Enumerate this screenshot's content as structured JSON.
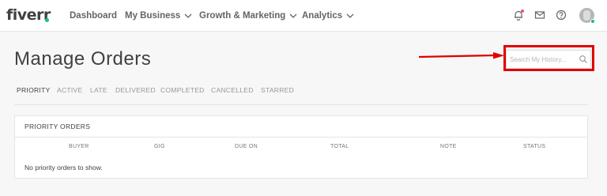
{
  "nav": {
    "logo": "fiverr",
    "items": [
      "Dashboard",
      "My Business",
      "Growth & Marketing",
      "Analytics"
    ],
    "icons": [
      "bell-icon",
      "envelope-icon",
      "help-icon"
    ]
  },
  "page": {
    "title": "Manage Orders"
  },
  "search": {
    "placeholder": "Search My History..."
  },
  "tabs": [
    "PRIORITY",
    "ACTIVE",
    "LATE",
    "DELIVERED",
    "COMPLETED",
    "CANCELLED",
    "STARRED"
  ],
  "orders": {
    "title": "PRIORITY ORDERS",
    "columns": [
      "BUYER",
      "GIG",
      "DUE ON",
      "TOTAL",
      "NOTE",
      "STATUS"
    ],
    "empty_message": "No priority orders to show."
  },
  "colors": {
    "brand_green": "#1dbf73",
    "annotation_red": "#e00000",
    "notification_dot": "#e74c8b"
  }
}
